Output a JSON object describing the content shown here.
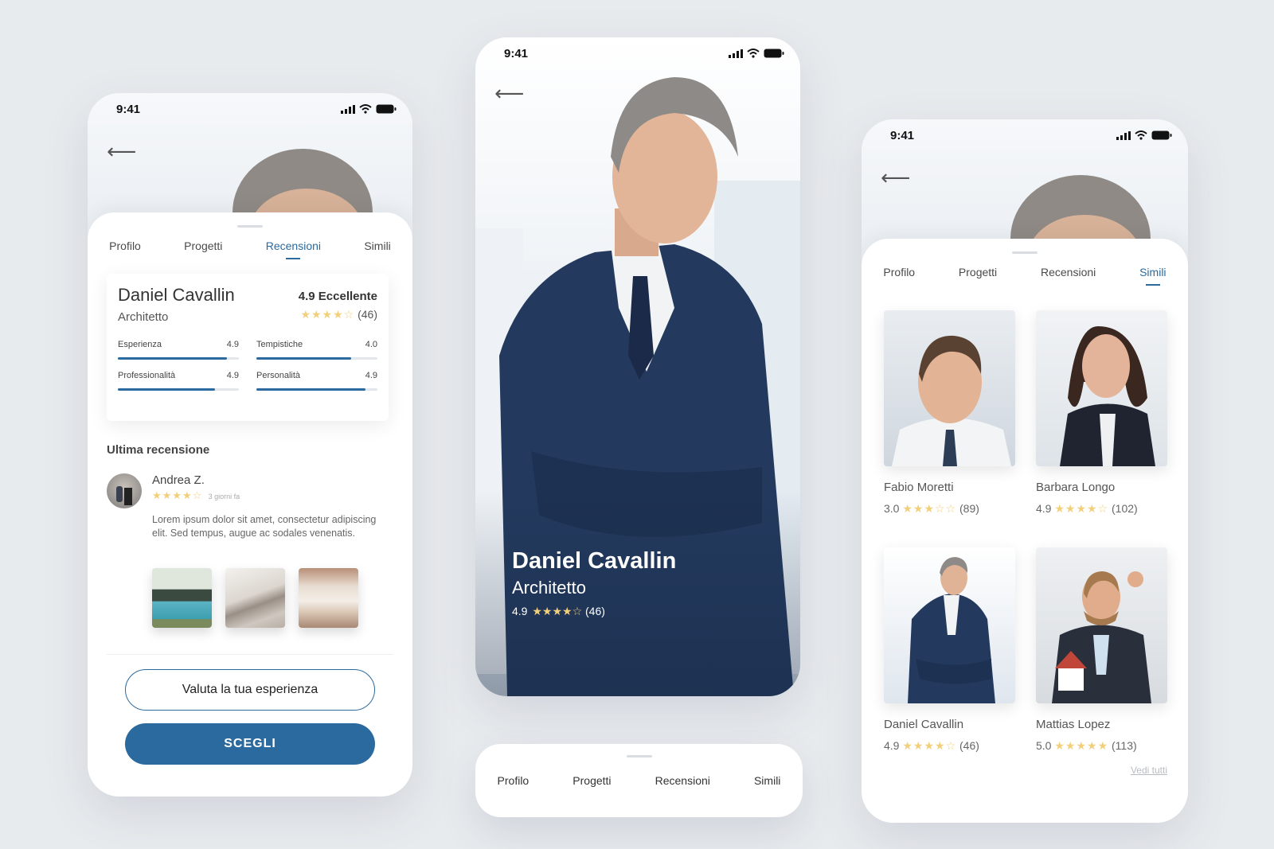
{
  "status_time": "9:41",
  "tabs": [
    "Profilo",
    "Progetti",
    "Recensioni",
    "Simili"
  ],
  "colors": {
    "accent": "#2b6a9e",
    "star": "#f2cf7a",
    "background": "#e8ebee"
  },
  "left": {
    "card": {
      "name": "Daniel Cavallin",
      "role": "Architetto",
      "score_label": "4.9 Eccellente",
      "stars_text": "★★★★☆",
      "reviews_count": "(46)",
      "metrics": [
        {
          "label": "Esperienza",
          "value": "4.9",
          "fill": 0.9
        },
        {
          "label": "Tempistiche",
          "value": "4.0",
          "fill": 0.78
        },
        {
          "label": "Professionalità",
          "value": "4.9",
          "fill": 0.8
        },
        {
          "label": "Personalità",
          "value": "4.9",
          "fill": 0.9
        }
      ]
    },
    "latest_title": "Ultima recensione",
    "review": {
      "author": "Andrea Z.",
      "stars_text": "★★★★☆",
      "time": "3 giorni fa",
      "text": "Lorem ipsum dolor sit amet, consectetur adipiscing elit. Sed tempus, augue ac sodales venenatis."
    },
    "rate_button": "Valuta la tua esperienza",
    "choose_button": "SCEGLI"
  },
  "middle": {
    "name": "Daniel Cavallin",
    "role": "Architetto",
    "rating": "4.9",
    "stars_text": "★★★★☆",
    "count": "(46)"
  },
  "right": {
    "profiles": [
      {
        "name": "Fabio Moretti",
        "rating": "3.0",
        "stars_text": "★★★☆☆",
        "count": "(89)"
      },
      {
        "name": "Barbara Longo",
        "rating": "4.9",
        "stars_text": "★★★★☆",
        "count": "(102)"
      },
      {
        "name": "Daniel Cavallin",
        "rating": "4.9",
        "stars_text": "★★★★☆",
        "count": "(46)"
      },
      {
        "name": "Mattias Lopez",
        "rating": "5.0",
        "stars_text": "★★★★★",
        "count": "(113)"
      }
    ],
    "see_all": "Vedi tutti"
  }
}
